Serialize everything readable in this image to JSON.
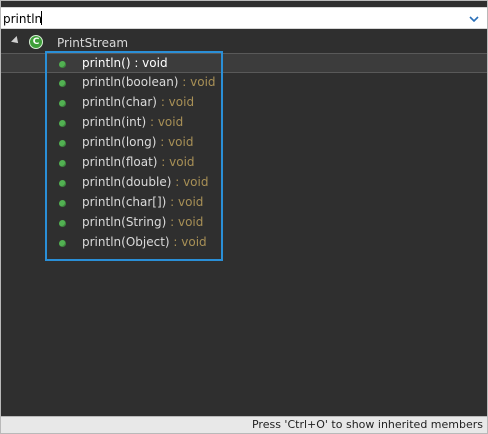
{
  "filter": {
    "value": "println",
    "dropdown_icon": "chevron-down-icon"
  },
  "tree": {
    "root": {
      "label": "PrintStream",
      "icon": "class-icon",
      "icon_letter": "C",
      "expanded": true
    },
    "methods": [
      {
        "name": "println()",
        "type": " : void",
        "selected": true
      },
      {
        "name": "println(boolean)",
        "type": " : void",
        "selected": false
      },
      {
        "name": "println(char)",
        "type": " : void",
        "selected": false
      },
      {
        "name": "println(int)",
        "type": " : void",
        "selected": false
      },
      {
        "name": "println(long)",
        "type": " : void",
        "selected": false
      },
      {
        "name": "println(float)",
        "type": " : void",
        "selected": false
      },
      {
        "name": "println(double)",
        "type": " : void",
        "selected": false
      },
      {
        "name": "println(char[])",
        "type": " : void",
        "selected": false
      },
      {
        "name": "println(String)",
        "type": " : void",
        "selected": false
      },
      {
        "name": "println(Object)",
        "type": " : void",
        "selected": false
      }
    ]
  },
  "status": {
    "text": "Press 'Ctrl+O' to show inherited members"
  },
  "colors": {
    "background": "#2f2f2f",
    "highlight_border": "#2a8fd7",
    "method_icon": "#52b152",
    "return_type": "#a89056"
  }
}
